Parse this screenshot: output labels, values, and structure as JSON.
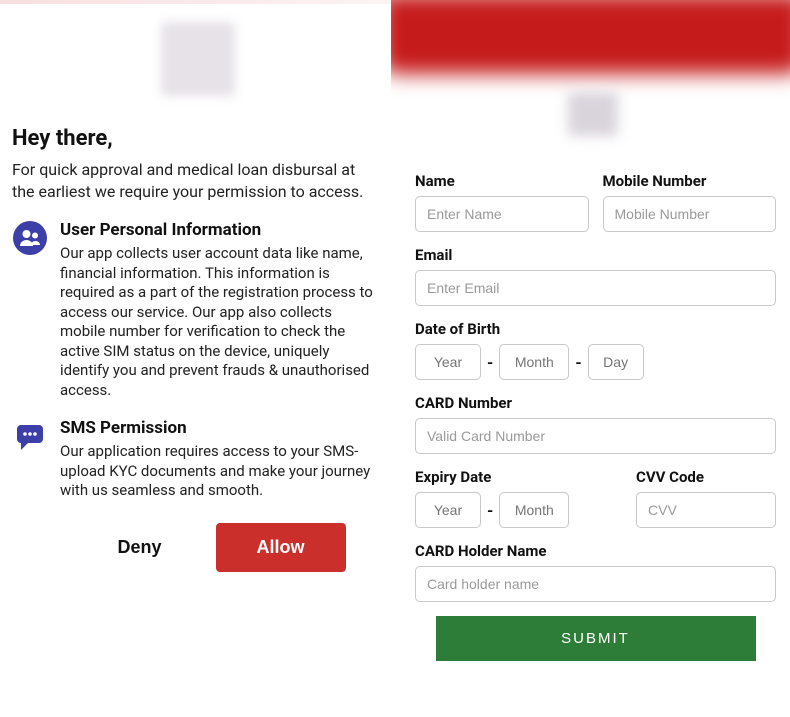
{
  "left": {
    "heading": "Hey there,",
    "intro": "For quick approval and medical loan disbursal at the earliest we require your permission to access.",
    "sections": [
      {
        "icon": "users-icon",
        "title": "User Personal Information",
        "text": "Our app collects user account data like name, financial information. This information is required as a part of the registration process to access our service. Our app also collects mobile number for verification to check the active SIM status on the device, uniquely identify you and prevent frauds & unauthorised access."
      },
      {
        "icon": "sms-icon",
        "title": "SMS Permission",
        "text": "Our application requires access to your SMS-upload KYC documents and make your journey with us seamless and smooth."
      }
    ],
    "deny_label": "Deny",
    "allow_label": "Allow"
  },
  "right": {
    "name_label": "Name",
    "name_placeholder": "Enter Name",
    "mobile_label": "Mobile Number",
    "mobile_placeholder": "Mobile Number",
    "email_label": "Email",
    "email_placeholder": "Enter Email",
    "dob_label": "Date of Birth",
    "dob_year_placeholder": "Year",
    "dob_month_placeholder": "Month",
    "dob_day_placeholder": "Day",
    "card_label": "CARD Number",
    "card_placeholder": "Valid Card Number",
    "expiry_label": "Expiry Date",
    "expiry_year_placeholder": "Year",
    "expiry_month_placeholder": "Month",
    "cvv_label": "CVV Code",
    "cvv_placeholder": "CVV",
    "holder_label": "CARD Holder Name",
    "holder_placeholder": "Card holder name",
    "submit_label": "SUBMIT"
  },
  "colors": {
    "deny_text": "#111111",
    "allow_bg": "#ca2f2c",
    "submit_bg": "#2d7d39",
    "icon_bg": "#3c3fa8"
  }
}
